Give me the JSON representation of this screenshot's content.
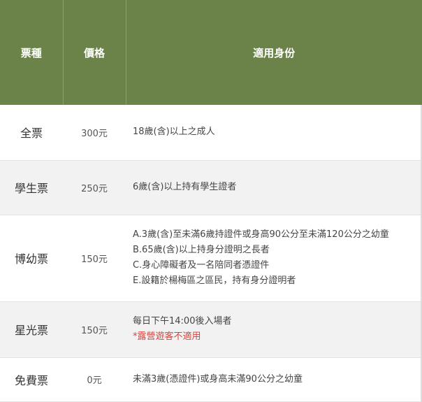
{
  "table": {
    "headers": [
      "票種",
      "價格",
      "適用身份"
    ],
    "rows": [
      {
        "type": "全票",
        "price": "300元",
        "lines": [
          "18歲(含)以上之成人"
        ],
        "note": ""
      },
      {
        "type": "學生票",
        "price": "250元",
        "lines": [
          "6歲(含)以上持有學生證者"
        ],
        "note": ""
      },
      {
        "type": "博幼票",
        "price": "150元",
        "lines": [
          "A.3歲(含)至未滿6歲持證件或身高90公分至未滿120公分之幼童",
          "B.65歲(含)以上持身分證明之長者",
          "C.身心障礙者及一名陪同者憑證件",
          "E.設籍於楊梅區之區民，持有身分證明者"
        ],
        "note": ""
      },
      {
        "type": "星光票",
        "price": "150元",
        "lines": [
          "每日下午14:00後入場者"
        ],
        "note": "*露營遊客不適用"
      },
      {
        "type": "免費票",
        "price": "0元",
        "lines": [
          "未滿3歲(憑證件)或身高未滿90公分之幼童"
        ],
        "note": ""
      }
    ]
  },
  "colors": {
    "header_bg": "#6b8348",
    "header_text": "#ffffff",
    "alt_row_bg": "#f2f2f2",
    "note_text": "#d9433b"
  }
}
